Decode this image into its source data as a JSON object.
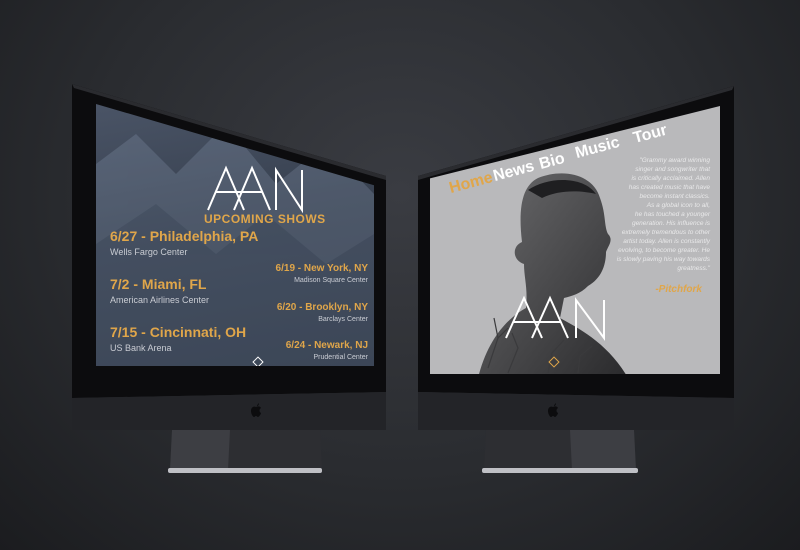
{
  "left_site": {
    "logo": "AAN",
    "heading": "UPCOMING SHOWS",
    "shows_left": [
      {
        "date": "6/27 - Philadelphia, PA",
        "venue": "Wells Fargo Center"
      },
      {
        "date": "7/2 - Miami, FL",
        "venue": "American Airlines Center"
      },
      {
        "date": "7/15 - Cincinnati, OH",
        "venue": "US Bank Arena"
      }
    ],
    "shows_right": [
      {
        "date": "6/19 - New York, NY",
        "venue": "Madison Square Center"
      },
      {
        "date": "6/20 - Brooklyn, NY",
        "venue": "Barclays Center"
      },
      {
        "date": "6/24 - Newark, NJ",
        "venue": "Prudential Center"
      }
    ]
  },
  "right_site": {
    "nav": [
      "Home",
      "News",
      "Bio",
      "Music",
      "Tour"
    ],
    "active_nav": "Home",
    "quote_lines": [
      "\"Grammy award winning",
      "singer and songwriter that",
      "is critically acclaimed. Allen",
      "has created music that have",
      "become instant classics.",
      "As a global icon to all,",
      "he has touched a younger",
      "generation. His influence is",
      "extremely tremendous to other",
      "artist today. Allen is constantly",
      "evolving, to become greater. He",
      "is slowly paving his way towards",
      "greatness.\""
    ],
    "quote_source": "-Pitchfork",
    "logo": "AAN"
  },
  "colors": {
    "accent": "#e0a64a",
    "background": "#2a2c30"
  }
}
